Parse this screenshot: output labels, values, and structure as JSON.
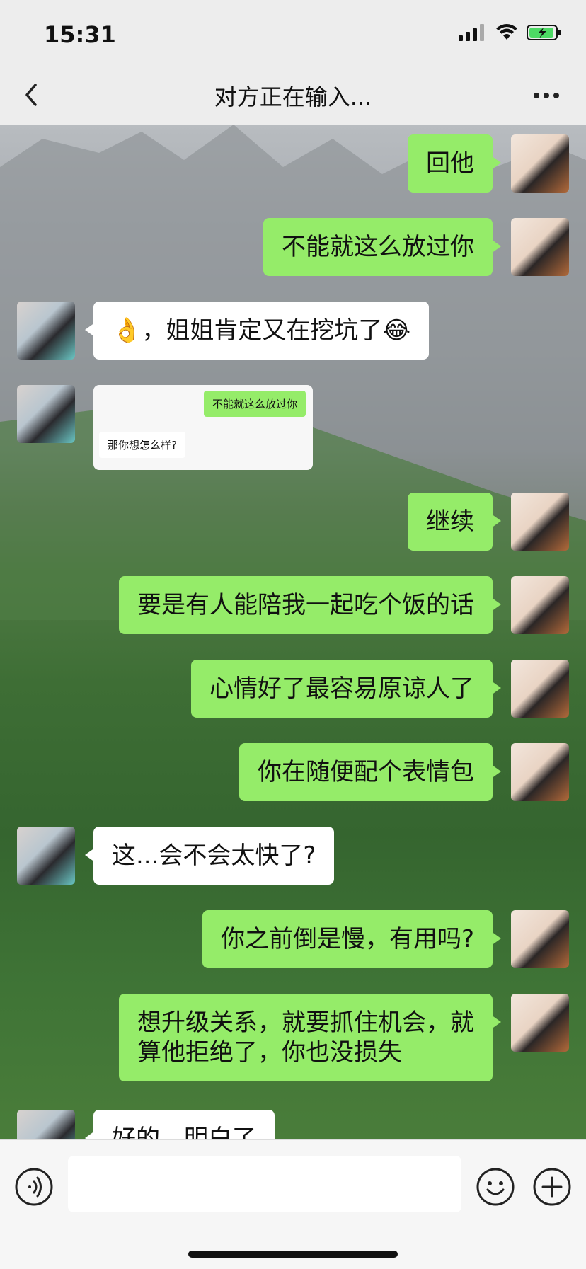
{
  "status": {
    "time": "15:31"
  },
  "nav": {
    "title": "对方正在输入..."
  },
  "messages": [
    {
      "side": "right",
      "text": "回他"
    },
    {
      "side": "right",
      "text": "不能就这么放过你"
    },
    {
      "side": "left",
      "text": "👌，姐姐肯定又在挖坑了😂"
    },
    {
      "side": "left",
      "type": "screenshot",
      "quoted_right": "不能就这么放过你",
      "quoted_left": "那你想怎么样?"
    },
    {
      "side": "right",
      "text": "继续"
    },
    {
      "side": "right",
      "text": "要是有人能陪我一起吃个饭的话"
    },
    {
      "side": "right",
      "text": "心情好了最容易原谅人了"
    },
    {
      "side": "right",
      "text": "你在随便配个表情包"
    },
    {
      "side": "left",
      "text": "这...会不会太快了?"
    },
    {
      "side": "right",
      "text": "你之前倒是慢，有用吗?"
    },
    {
      "side": "right",
      "text_line1": "想升级关系，就要抓住机会，就",
      "text_line2": "算他拒绝了，你也没损失"
    },
    {
      "side": "left",
      "text": "好的，明白了"
    }
  ],
  "input": {
    "placeholder": ""
  },
  "icons": {
    "back": "chevron-left-icon",
    "more": "more-dots-icon",
    "voice": "voice-icon",
    "emoji": "emoji-icon",
    "plus": "plus-icon"
  },
  "colors": {
    "bubble_right": "#95ec69",
    "bubble_left": "#ffffff",
    "bar_bg": "#ededed"
  }
}
